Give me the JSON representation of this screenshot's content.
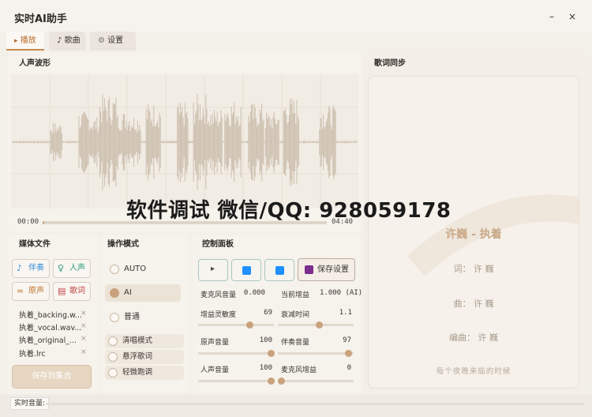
{
  "app": {
    "title": "实时AI助手",
    "minimize": "–",
    "close": "×"
  },
  "tabs": [
    {
      "icon": "▸",
      "label": "播放"
    },
    {
      "icon": "♪",
      "label": "歌曲"
    },
    {
      "icon": "⚙",
      "label": "设置"
    }
  ],
  "waveform": {
    "title": "人声波形",
    "time_start": "00:00",
    "time_end": "04:40",
    "progress": 0.006
  },
  "watermark": "软件调试 微信/QQ: 928059178",
  "lyrics": {
    "title": "歌词同步",
    "song": "许巍 - 执着",
    "lyricist": "词： 许 巍",
    "composer": "曲： 许 巍",
    "arranger": "编曲： 许 巍",
    "current_line": "每个夜晚来临的时候"
  },
  "media": {
    "title": "媒体文件",
    "buttons": [
      {
        "icon": "♪",
        "label": "伴奏",
        "color": "#3a8fd6"
      },
      {
        "icon": "♀",
        "label": "人声",
        "color": "#2e9a78"
      },
      {
        "icon": "≈",
        "label": "原声",
        "color": "#c0762e"
      },
      {
        "icon": "▤",
        "label": "歌词",
        "color": "#c04040"
      }
    ],
    "files": [
      {
        "name": "执着_backing.w..."
      },
      {
        "name": "执着_vocal.wav..."
      },
      {
        "name": "执着_original_..."
      },
      {
        "name": "执着.lrc"
      }
    ],
    "remove": "×",
    "save_label": "保存到集合"
  },
  "mode": {
    "title": "操作模式",
    "options": [
      {
        "label": "AUTO",
        "selected": false
      },
      {
        "label": "AI",
        "selected": true
      },
      {
        "label": "普通",
        "selected": false
      }
    ],
    "extras": [
      {
        "label": "清唱模式"
      },
      {
        "label": "悬浮歌词"
      },
      {
        "label": "轻微跑调"
      }
    ]
  },
  "control": {
    "title": "控制面板",
    "play_icon": "▸",
    "save_label": "保存设置",
    "mic_volume_label": "麦克风音量",
    "mic_volume_value": "0.000",
    "gain_label": "当前增益",
    "gain_value": "1.000 (AI)",
    "sliders": [
      {
        "label": "增益灵敏度",
        "value": "69",
        "level": 0.69
      },
      {
        "label": "衰减时间",
        "value": "1.1",
        "level": 0.55
      },
      {
        "label": "原声音量",
        "value": "100",
        "level": 1.0
      },
      {
        "label": "伴奏音量",
        "value": "97",
        "level": 0.97
      },
      {
        "label": "人声音量",
        "value": "100",
        "level": 1.0
      },
      {
        "label": "麦克风增益",
        "value": "0",
        "level": 0.0
      }
    ]
  },
  "status": {
    "label": "实时音量:",
    "level": 0.0
  }
}
